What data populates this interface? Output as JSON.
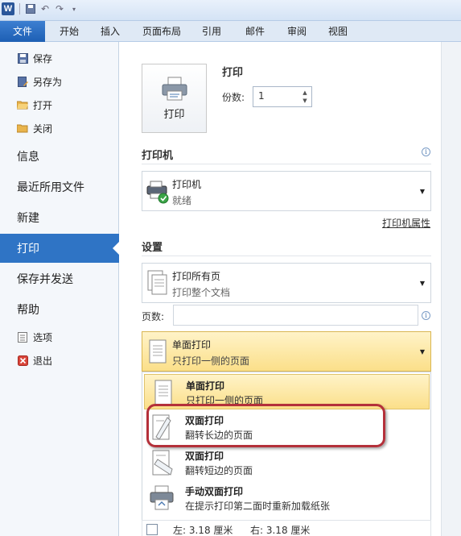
{
  "qat": {
    "logo": "W"
  },
  "ribbon": {
    "tabs": [
      "文件",
      "开始",
      "插入",
      "页面布局",
      "引用",
      "邮件",
      "审阅",
      "视图"
    ]
  },
  "backstage": {
    "small_items": [
      "保存",
      "另存为",
      "打开",
      "关闭"
    ],
    "big_items": [
      "信息",
      "最近所用文件",
      "新建",
      "打印",
      "保存并发送",
      "帮助"
    ],
    "bottom_items": [
      "选项",
      "退出"
    ]
  },
  "print": {
    "button_label": "打印",
    "title": "打印",
    "copies_label": "份数:",
    "copies_value": "1"
  },
  "printer": {
    "heading": "打印机",
    "name": "打印机",
    "status": "就绪",
    "properties_link": "打印机属性"
  },
  "settings": {
    "heading": "设置",
    "range_title": "打印所有页",
    "range_desc": "打印整个文档",
    "pages_label": "页数:",
    "pages_value": "",
    "duplex_title": "单面打印",
    "duplex_desc": "只打印一侧的页面"
  },
  "duplex_options": [
    {
      "title": "单面打印",
      "desc": "只打印一侧的页面"
    },
    {
      "title": "双面打印",
      "desc": "翻转长边的页面"
    },
    {
      "title": "双面打印",
      "desc": "翻转短边的页面"
    },
    {
      "title": "手动双面打印",
      "desc": "在提示打印第二面时重新加载纸张"
    }
  ],
  "margins": {
    "left": "左:  3.18 厘米",
    "right": "右:  3.18 厘米"
  },
  "colors": {
    "accent": "#2f74c5",
    "highlight": "#fbdf89",
    "annotation": "#b4303a"
  }
}
